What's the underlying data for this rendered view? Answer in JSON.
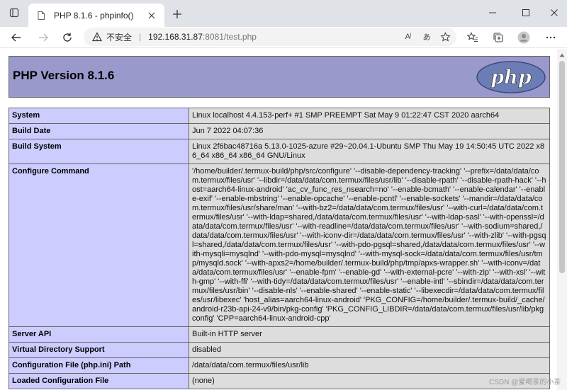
{
  "browser": {
    "tab_title": "PHP 8.1.6 - phpinfo()",
    "security_label": "不安全",
    "url_host": "192.168.31.87",
    "url_rest": ":8081/test.php",
    "read_aloud_label": "Aˡ",
    "translate_label": "あ"
  },
  "page": {
    "version_heading": "PHP Version 8.1.6",
    "logo_text": "php",
    "rows": [
      {
        "key": "System",
        "value": "Linux localhost 4.4.153-perf+ #1 SMP PREEMPT Sat May 9 01:22:47 CST 2020 aarch64"
      },
      {
        "key": "Build Date",
        "value": "Jun 7 2022 04:07:36"
      },
      {
        "key": "Build System",
        "value": "Linux 2f6bac48716a 5.13.0-1025-azure #29~20.04.1-Ubuntu SMP Thu May 19 14:50:45 UTC 2022 x86_64 x86_64 x86_64 GNU/Linux"
      },
      {
        "key": "Configure Command",
        "value": "'/home/builder/.termux-build/php/src/configure' '--disable-dependency-tracking' '--prefix=/data/data/com.termux/files/usr' '--libdir=/data/data/com.termux/files/usr/lib' '--disable-rpath' '--disable-rpath-hack' '--host=aarch64-linux-android' 'ac_cv_func_res_nsearch=no' '--enable-bcmath' '--enable-calendar' '--enable-exif' '--enable-mbstring' '--enable-opcache' '--enable-pcntl' '--enable-sockets' '--mandir=/data/data/com.termux/files/usr/share/man' '--with-bz2=/data/data/com.termux/files/usr' '--with-curl=/data/data/com.termux/files/usr' '--with-ldap=shared,/data/data/com.termux/files/usr' '--with-ldap-sasl' '--with-openssl=/data/data/com.termux/files/usr' '--with-readline=/data/data/com.termux/files/usr' '--with-sodium=shared,/data/data/com.termux/files/usr' '--with-iconv-dir=/data/data/com.termux/files/usr' '--with-zlib' '--with-pgsql=shared,/data/data/com.termux/files/usr' '--with-pdo-pgsql=shared,/data/data/com.termux/files/usr' '--with-mysqli=mysqlnd' '--with-pdo-mysql=mysqlnd' '--with-mysql-sock=/data/data/com.termux/files/usr/tmp/mysqld.sock' '--with-apxs2=/home/builder/.termux-build/php/tmp/apxs-wrapper.sh' '--with-iconv=/data/data/com.termux/files/usr' '--enable-fpm' '--enable-gd' '--with-external-pcre' '--with-zip' '--with-xsl' '--with-gmp' '--with-ffi' '--with-tidy=/data/data/com.termux/files/usr' '--enable-intl' '--sbindir=/data/data/com.termux/files/usr/bin' '--disable-nls' '--enable-shared' '--enable-static' '--libexecdir=/data/data/com.termux/files/usr/libexec' 'host_alias=aarch64-linux-android' 'PKG_CONFIG=/home/builder/.termux-build/_cache/android-r23b-api-24-v9/bin/pkg-config' 'PKG_CONFIG_LIBDIR=/data/data/com.termux/files/usr/lib/pkgconfig' 'CPP=aarch64-linux-android-cpp'"
      },
      {
        "key": "Server API",
        "value": "Built-in HTTP server"
      },
      {
        "key": "Virtual Directory Support",
        "value": "disabled"
      },
      {
        "key": "Configuration File (php.ini) Path",
        "value": "/data/data/com.termux/files/usr/lib"
      },
      {
        "key": "Loaded Configuration File",
        "value": "(none)"
      }
    ]
  },
  "watermark": "CSDN @爱喝茶的小茶",
  "colors": {
    "header_bg": "#9999cc",
    "key_bg": "#ccccff",
    "value_bg": "#dddddd"
  }
}
